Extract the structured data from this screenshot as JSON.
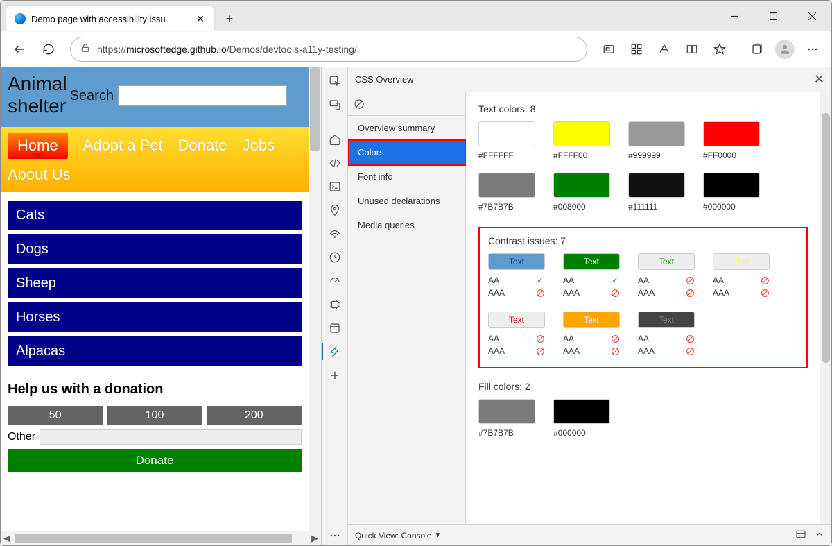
{
  "browser": {
    "tab_title": "Demo page with accessibility issu",
    "url_lock": "🔒",
    "url_prefix": "https://",
    "url_host": "microsoftedge.github.io",
    "url_path": "/Demos/devtools-a11y-testing/"
  },
  "page": {
    "title_line1": "Animal",
    "title_line2": "shelter",
    "search_label": "Search",
    "nav": [
      "Home",
      "Adopt a Pet",
      "Donate",
      "Jobs",
      "About Us"
    ],
    "animals": [
      "Cats",
      "Dogs",
      "Sheep",
      "Horses",
      "Alpacas"
    ],
    "donation_heading": "Help us with a donation",
    "donation_amounts": [
      "50",
      "100",
      "200"
    ],
    "other_label": "Other",
    "donate_btn": "Donate"
  },
  "devtools": {
    "panel_title": "CSS Overview",
    "sidebar": [
      "Overview summary",
      "Colors",
      "Font info",
      "Unused declarations",
      "Media queries"
    ],
    "sidebar_selected": 1,
    "text_colors_label": "Text colors: 8",
    "text_colors": [
      "#FFFFFF",
      "#FFFF00",
      "#999999",
      "#FF0000",
      "#7B7B7B",
      "#008000",
      "#111111",
      "#000000"
    ],
    "contrast_label": "Contrast issues: 7",
    "contrast_items": [
      {
        "bg": "#5e9ccf",
        "fg": "#003b7a",
        "aa": "ok",
        "aaa": "no"
      },
      {
        "bg": "#008000",
        "fg": "#ffffff",
        "aa": "ok",
        "aaa": "no"
      },
      {
        "bg": "#eeeeee",
        "fg": "#00a000",
        "aa": "no",
        "aaa": "no"
      },
      {
        "bg": "#eeeeee",
        "fg": "#ffff00",
        "aa": "no",
        "aaa": "no"
      },
      {
        "bg": "#eeeeee",
        "fg": "#ff0000",
        "aa": "no",
        "aaa": "no"
      },
      {
        "bg": "#ffa500",
        "fg": "#ffffff",
        "aa": "no",
        "aaa": "no"
      },
      {
        "bg": "#444444",
        "fg": "#888888",
        "aa": "no",
        "aaa": "no"
      }
    ],
    "contrast_text": "Text",
    "aa_label": "AA",
    "aaa_label": "AAA",
    "fill_colors_label": "Fill colors: 2",
    "fill_colors": [
      "#7B7B7B",
      "#000000"
    ],
    "footer_quickview": "Quick View:",
    "footer_console": "Console"
  }
}
